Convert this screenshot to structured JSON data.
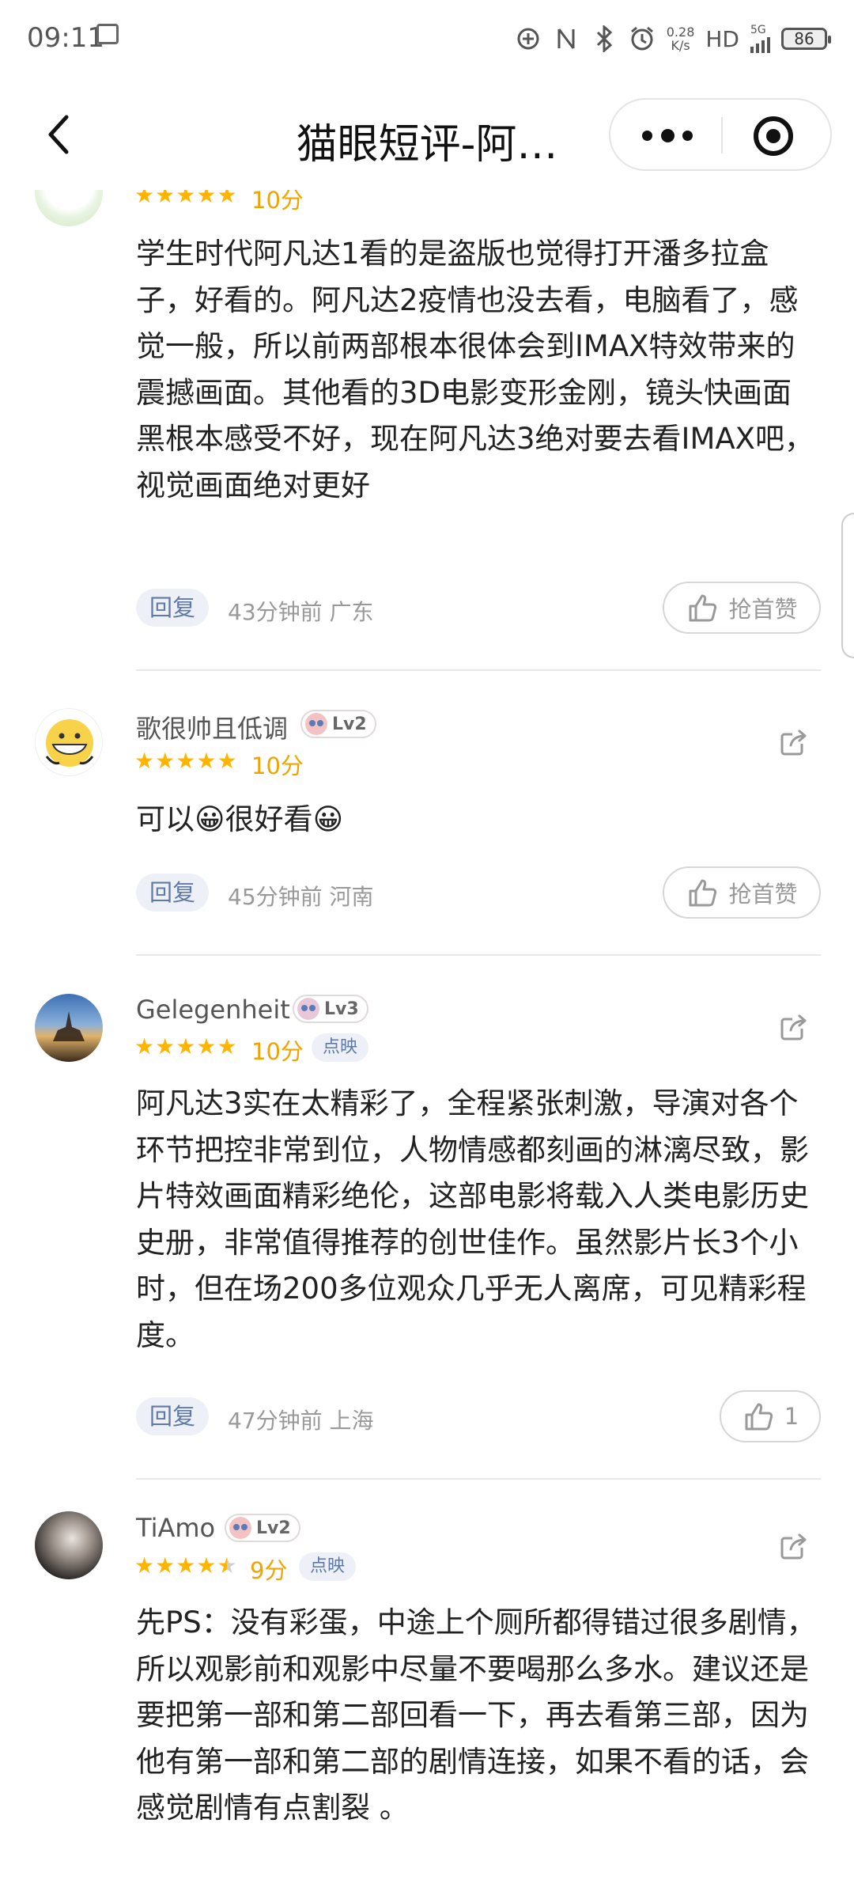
{
  "status_bar": {
    "time": "09:11",
    "speed_value": "0.28",
    "speed_unit": "K/s",
    "hd": "HD",
    "network": "5G",
    "battery": "86"
  },
  "nav": {
    "title": "猫眼短评-阿…"
  },
  "comments": [
    {
      "stars": 5,
      "score": "10分",
      "text": "学生时代阿凡达1看的是盗版也觉得打开潘多拉盒子，好看的。阿凡达2疫情也没去看，电脑看了，感觉一般，所以前两部根本很体会到IMAX特效带来的震撼画面。其他看的3D电影变形金刚，镜头快画面黑根本感受不好，现在阿凡达3绝对要去看IMAX吧，视觉画面绝对更好",
      "reply": "回复",
      "meta": "43分钟前 广东",
      "like": "抢首赞"
    },
    {
      "username": "歌很帅且低调",
      "level": "Lv2",
      "stars": 5,
      "score": "10分",
      "text": "可以😀很好看😀",
      "reply": "回复",
      "meta": "45分钟前 河南",
      "like": "抢首赞"
    },
    {
      "username": "Gelegenheit",
      "level": "Lv3",
      "stars": 5,
      "score": "10分",
      "tag": "点映",
      "text": "阿凡达3实在太精彩了，全程紧张刺激，导演对各个环节把控非常到位，人物情感都刻画的淋漓尽致，影片特效画面精彩绝伦，这部电影将载入人类电影历史史册，非常值得推荐的创世佳作。虽然影片长3个小时，但在场200多位观众几乎无人离席，可见精彩程度。",
      "reply": "回复",
      "meta": "47分钟前 上海",
      "like": "1"
    },
    {
      "username": "TiAmo",
      "level": "Lv2",
      "stars": 4.5,
      "score": "9分",
      "tag": "点映",
      "text": "先PS：没有彩蛋，中途上个厕所都得错过很多剧情，所以观影前和观影中尽量不要喝那么多水。建议还是要把第一部和第二部回看一下，再去看第三部，因为他有第一部和第二部的剧情连接，如果不看的话，会感觉剧情有点割裂 。"
    }
  ],
  "icons": {
    "back": "chevron-left-icon",
    "more": "more-dots-icon",
    "target": "target-icon",
    "share": "share-icon",
    "like": "thumb-up-icon"
  },
  "colors": {
    "star": "#ffb400",
    "score": "#f0a400",
    "tag_text": "#6079a6",
    "tag_bg": "#edf1f7"
  }
}
